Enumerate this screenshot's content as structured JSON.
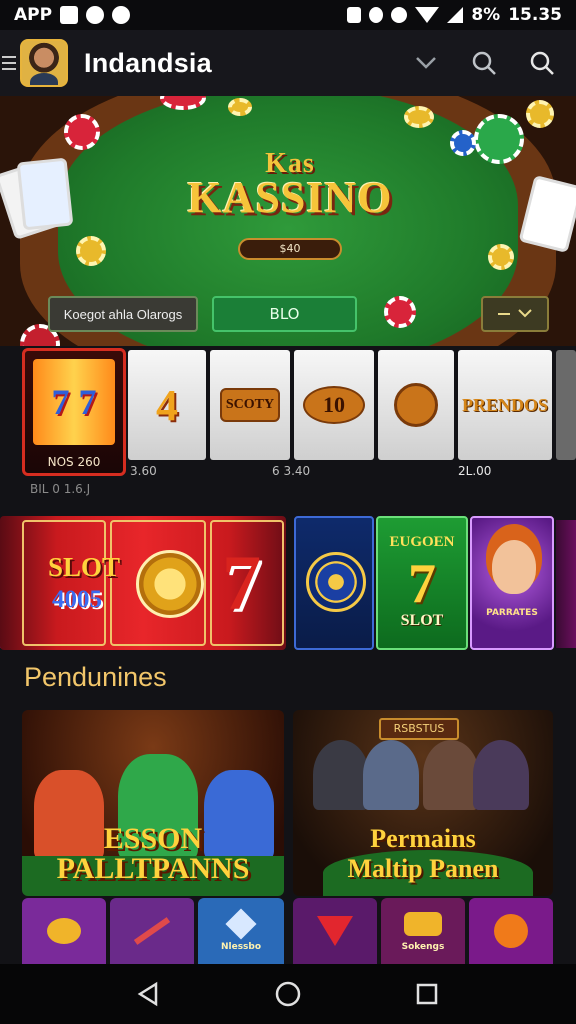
{
  "status_bar": {
    "left_text": "APP",
    "battery_text": "8%",
    "time": "15.35",
    "icons": [
      "notification-icon",
      "whatsapp-icon",
      "location-icon",
      "vibrate-icon",
      "sync-icon",
      "alarm-icon",
      "wifi-icon",
      "signal-icon"
    ]
  },
  "header": {
    "title": "Indandsia",
    "icons": [
      "menu-icon",
      "avatar",
      "chevron-down-icon",
      "search-icon",
      "search-icon"
    ]
  },
  "hero": {
    "logo_top": "Kas",
    "logo_main": "KASSINO",
    "price": "$40",
    "controls": {
      "left": "Koegot ahla Olarogs",
      "middle": "BLO",
      "right_icon": "chevron-down-icon"
    }
  },
  "slots": {
    "tiles": [
      {
        "text": "7 7",
        "price": "NOS 260"
      },
      {
        "text": "4"
      },
      {
        "text": "SCOTY"
      },
      {
        "text": "10"
      },
      {
        "text": ""
      },
      {
        "text": "PRENDOS"
      }
    ],
    "labels": [
      "3.60",
      "6 3.40",
      "2L.00"
    ],
    "subtitle": "BIL 0 1.6.J"
  },
  "banners": {
    "red": {
      "line1": "SLOT",
      "line2": "4005",
      "seven": "7"
    },
    "green": {
      "top": "EUGOEN",
      "seven": "7",
      "bottom": "SLOT"
    },
    "purple": {
      "label": "PARRATES"
    }
  },
  "section": {
    "title": "Pendunines"
  },
  "featured": [
    {
      "line1": "ESSON",
      "line2": "PALLTPANNS"
    },
    {
      "sign": "RSBSTUS",
      "line1": "Permains",
      "line2": "Maltip Panen"
    }
  ],
  "mini_tiles": [
    "",
    "",
    "Nlessbo",
    "",
    "Sokengs",
    ""
  ],
  "navigation": [
    "back-icon",
    "home-icon",
    "recents-icon"
  ]
}
